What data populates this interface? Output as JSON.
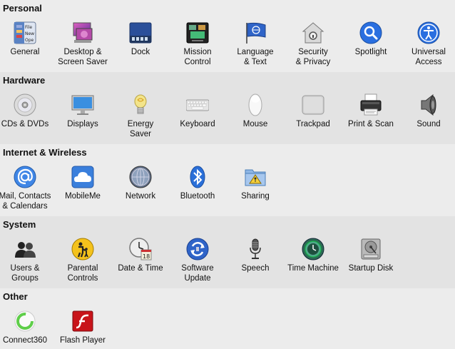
{
  "sections": [
    {
      "title": "Personal",
      "items": [
        {
          "label": "General",
          "icon": "general-icon"
        },
        {
          "label": "Desktop &\nScreen Saver",
          "icon": "desktop-screensaver-icon"
        },
        {
          "label": "Dock",
          "icon": "dock-icon"
        },
        {
          "label": "Mission\nControl",
          "icon": "mission-control-icon"
        },
        {
          "label": "Language\n& Text",
          "icon": "language-text-icon"
        },
        {
          "label": "Security\n& Privacy",
          "icon": "security-privacy-icon"
        },
        {
          "label": "Spotlight",
          "icon": "spotlight-icon"
        },
        {
          "label": "Universal\nAccess",
          "icon": "universal-access-icon"
        }
      ]
    },
    {
      "title": "Hardware",
      "items": [
        {
          "label": "CDs & DVDs",
          "icon": "cds-dvds-icon"
        },
        {
          "label": "Displays",
          "icon": "displays-icon"
        },
        {
          "label": "Energy\nSaver",
          "icon": "energy-saver-icon"
        },
        {
          "label": "Keyboard",
          "icon": "keyboard-icon"
        },
        {
          "label": "Mouse",
          "icon": "mouse-icon"
        },
        {
          "label": "Trackpad",
          "icon": "trackpad-icon"
        },
        {
          "label": "Print & Scan",
          "icon": "print-scan-icon"
        },
        {
          "label": "Sound",
          "icon": "sound-icon"
        }
      ]
    },
    {
      "title": "Internet & Wireless",
      "items": [
        {
          "label": "Mail, Contacts\n& Calendars",
          "icon": "mail-contacts-icon"
        },
        {
          "label": "MobileMe",
          "icon": "mobileme-icon"
        },
        {
          "label": "Network",
          "icon": "network-icon"
        },
        {
          "label": "Bluetooth",
          "icon": "bluetooth-icon"
        },
        {
          "label": "Sharing",
          "icon": "sharing-icon"
        }
      ]
    },
    {
      "title": "System",
      "items": [
        {
          "label": "Users &\nGroups",
          "icon": "users-groups-icon"
        },
        {
          "label": "Parental\nControls",
          "icon": "parental-controls-icon"
        },
        {
          "label": "Date & Time",
          "icon": "date-time-icon"
        },
        {
          "label": "Software\nUpdate",
          "icon": "software-update-icon"
        },
        {
          "label": "Speech",
          "icon": "speech-icon"
        },
        {
          "label": "Time Machine",
          "icon": "time-machine-icon"
        },
        {
          "label": "Startup Disk",
          "icon": "startup-disk-icon"
        }
      ]
    },
    {
      "title": "Other",
      "items": [
        {
          "label": "Connect360",
          "icon": "connect360-icon"
        },
        {
          "label": "Flash Player",
          "icon": "flash-player-icon"
        }
      ]
    }
  ],
  "icon_text": {
    "general_file": "File",
    "general_new": "New",
    "general_open": "Ope",
    "date_day": "18"
  }
}
